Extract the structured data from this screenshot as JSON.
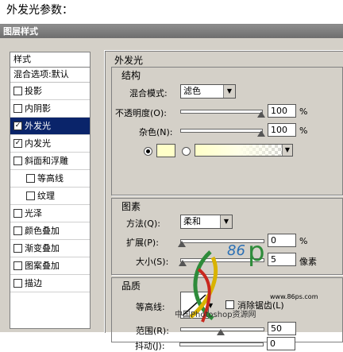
{
  "caption": "外发光参数：",
  "dialog": {
    "title": "图层样式"
  },
  "style_list": {
    "header": "样式",
    "blend_options": "混合选项:默认",
    "items": [
      {
        "label": "投影",
        "checked": false,
        "indent": false,
        "selected": false
      },
      {
        "label": "内阴影",
        "checked": false,
        "indent": false,
        "selected": false
      },
      {
        "label": "外发光",
        "checked": true,
        "indent": false,
        "selected": true
      },
      {
        "label": "内发光",
        "checked": true,
        "indent": false,
        "selected": false
      },
      {
        "label": "斜面和浮雕",
        "checked": false,
        "indent": false,
        "selected": false
      },
      {
        "label": "等高线",
        "checked": false,
        "indent": true,
        "selected": false
      },
      {
        "label": "纹理",
        "checked": false,
        "indent": true,
        "selected": false
      },
      {
        "label": "光泽",
        "checked": false,
        "indent": false,
        "selected": false
      },
      {
        "label": "颜色叠加",
        "checked": false,
        "indent": false,
        "selected": false
      },
      {
        "label": "渐变叠加",
        "checked": false,
        "indent": false,
        "selected": false
      },
      {
        "label": "图案叠加",
        "checked": false,
        "indent": false,
        "selected": false
      },
      {
        "label": "描边",
        "checked": false,
        "indent": false,
        "selected": false
      }
    ]
  },
  "panel": {
    "title": "外发光",
    "structure": {
      "title": "结构",
      "blend_mode_label": "混合模式:",
      "blend_mode_value": "滤色",
      "opacity_label": "不透明度(O):",
      "opacity_value": "100",
      "opacity_unit": "%",
      "noise_label": "杂色(N):",
      "noise_value": "100",
      "noise_unit": "%",
      "glow_color": "#ffffc8"
    },
    "elements": {
      "title": "图素",
      "method_label": "方法(Q):",
      "method_value": "柔和",
      "spread_label": "扩展(P):",
      "spread_value": "0",
      "spread_unit": "%",
      "size_label": "大小(S):",
      "size_value": "5",
      "size_unit": "像素"
    },
    "quality": {
      "title": "品质",
      "contour_label": "等高线:",
      "antialias_label": "消除锯齿(L)",
      "range_label": "范围(R):",
      "range_value": "50",
      "jitter_label": "抖动(J):",
      "jitter_value": "0"
    }
  },
  "watermark": {
    "number": "86",
    "letter": "p",
    "url": "www.86ps.com",
    "text": "中国Photoshop资源网"
  }
}
